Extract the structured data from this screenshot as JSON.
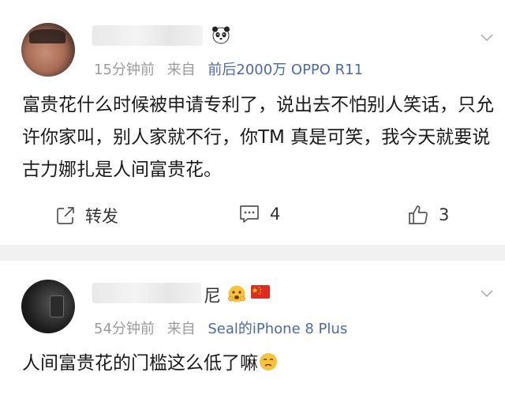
{
  "post1": {
    "timestamp": "15分钟前",
    "from_label": "来自",
    "source": "前后2000万 OPPO R11",
    "text": "富贵花什么时候被申请专利了，说出去不怕别人笑话，只允许你家叫，别人家就不行，你TM 真是可笑，我今天就要说古力娜扎是人间富贵花。",
    "actions": {
      "repost_label": "转发",
      "comment_count": "4",
      "like_count": "3"
    }
  },
  "post2": {
    "name_suffix": "尼",
    "timestamp": "54分钟前",
    "from_label": "来自",
    "source": "Seal的iPhone 8 Plus",
    "text": "人间富贵花的门槛这么低了嘛"
  },
  "colors": {
    "source_link": "#4a6aa8",
    "meta_gray": "#9b9b9b",
    "divider": "#f1f1f1"
  },
  "icons": {
    "panda": "panda-emoji",
    "chevron": "chevron-down-icon",
    "repost": "share-icon",
    "comment": "comment-icon",
    "like": "thumbs-up-icon",
    "flag": "china-flag-emoji",
    "face": "face-emoji"
  }
}
